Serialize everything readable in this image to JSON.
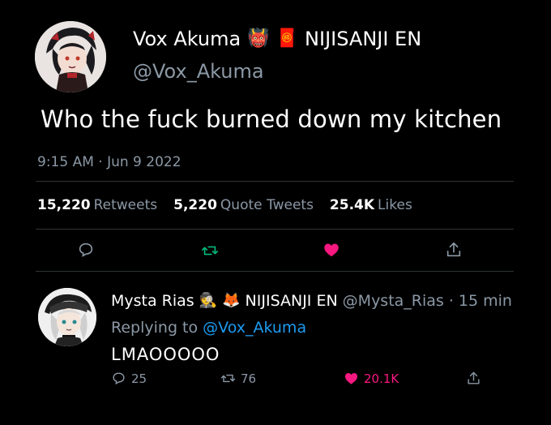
{
  "main_tweet": {
    "display_name": "Vox Akuma",
    "emoji_1": "👹",
    "emoji_2": "🧧",
    "affiliation": "NIJISANJI EN",
    "handle": "@Vox_Akuma",
    "text": "Who the fuck burned down my kitchen",
    "timestamp": "9:15 AM · Jun 9 2022",
    "stats": {
      "retweets_count": "15,220",
      "retweets_label": "Retweets",
      "quote_count": "5,220",
      "quote_label": "Quote Tweets",
      "likes_count": "25.4K",
      "likes_label": "Likes"
    },
    "liked": true
  },
  "reply": {
    "display_name": "Mysta Rias",
    "emoji_1": "🕵",
    "emoji_2": "🦊",
    "affiliation": "NIJISANJI EN",
    "handle": "@Mysta_Rias",
    "separator": "·",
    "time": "15 min",
    "replying_prefix": "Replying to",
    "replying_to": "@Vox_Akuma",
    "text": "LMAOOOOO",
    "reply_count": "25",
    "retweet_count": "76",
    "like_count": "20.1K",
    "liked": true
  },
  "colors": {
    "background": "#000000",
    "text_primary": "#ffffff",
    "text_secondary": "#8b98a5",
    "link": "#1d9bf0",
    "like": "#f91880",
    "retweet": "#00ba7c",
    "divider": "#2f3336"
  },
  "icons": {
    "reply": "comment-icon",
    "retweet": "retweet-icon",
    "like": "heart-icon",
    "share": "share-icon"
  }
}
